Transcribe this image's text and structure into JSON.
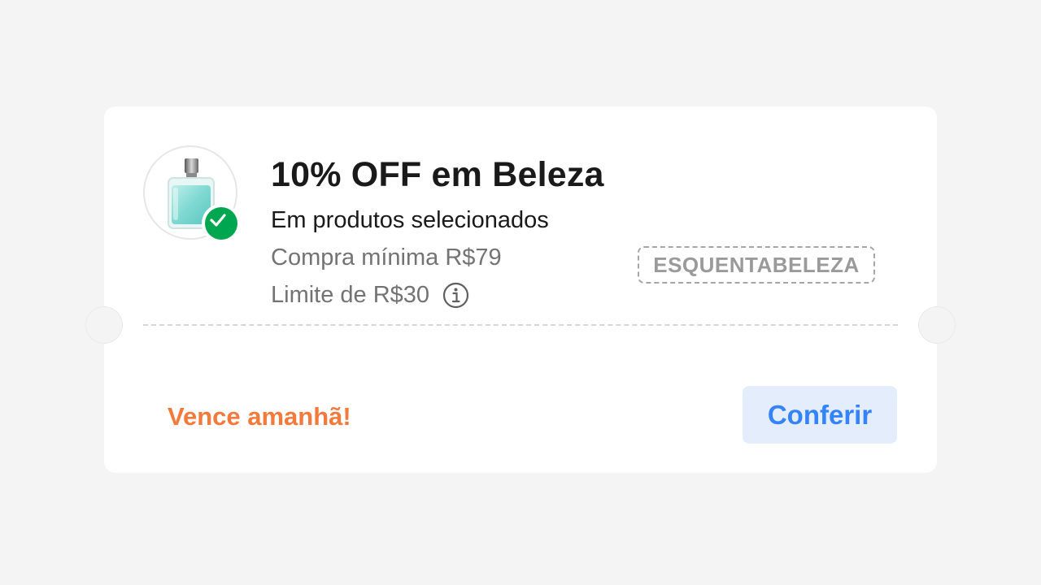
{
  "coupon": {
    "title": "10% OFF em Beleza",
    "subtitle": "Em produtos selecionados",
    "min_purchase": "Compra mínima R$79",
    "limit": "Limite de R$30",
    "code": "ESQUENTABELEZA",
    "expiry": "Vence amanhã!",
    "cta_label": "Conferir",
    "product_icon": "perfume-bottle-icon",
    "badge_icon": "check-icon",
    "info_icon": "info-icon"
  },
  "colors": {
    "background": "#f4f4f4",
    "card": "#ffffff",
    "title": "#1a1a1a",
    "muted": "#737373",
    "success": "#00a650",
    "expiry": "#f37a3b",
    "accent": "#3483fa",
    "accent_bg": "#e3edfb"
  }
}
